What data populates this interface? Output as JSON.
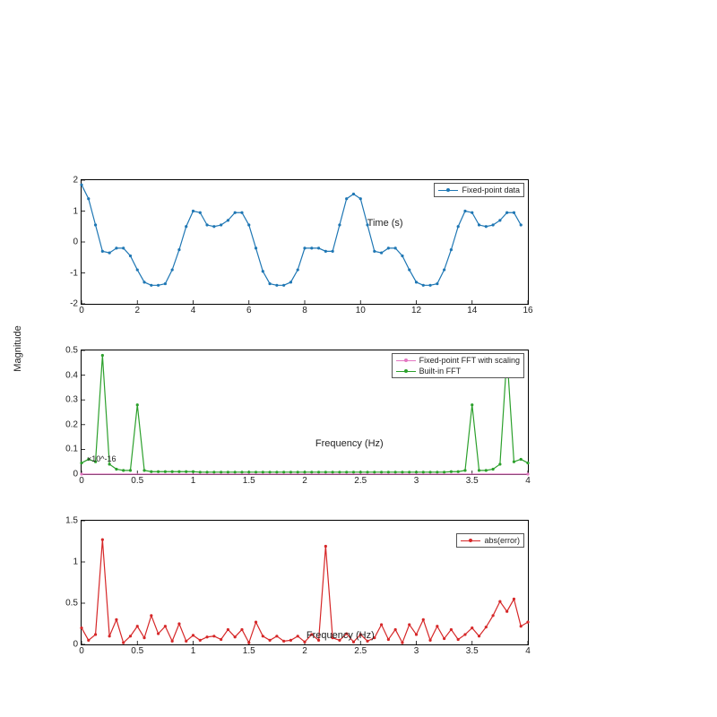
{
  "ylabel_shared": "Magnitude",
  "chart_data": [
    {
      "type": "line",
      "title": "",
      "xlabel_inplot": "Time (s)",
      "xlim": [
        0,
        16
      ],
      "ylim": [
        -2,
        2
      ],
      "xticks": [
        0,
        2,
        4,
        6,
        8,
        10,
        12,
        14,
        16
      ],
      "yticks": [
        -2,
        -1,
        0,
        1,
        2
      ],
      "legend": [
        {
          "name": "Fixed-point data",
          "color": "#1f77b4"
        }
      ],
      "series": [
        {
          "name": "Fixed-point data",
          "color": "#1f77b4",
          "x": [
            0,
            0.25,
            0.5,
            0.75,
            1,
            1.25,
            1.5,
            1.75,
            2,
            2.25,
            2.5,
            2.75,
            3,
            3.25,
            3.5,
            3.75,
            4,
            4.25,
            4.5,
            4.75,
            5,
            5.25,
            5.5,
            5.75,
            6,
            6.25,
            6.5,
            6.75,
            7,
            7.25,
            7.5,
            7.75,
            8,
            8.25,
            8.5,
            8.75,
            9,
            9.25,
            9.5,
            9.75,
            10,
            10.25,
            10.5,
            10.75,
            11,
            11.25,
            11.5,
            11.75,
            12,
            12.25,
            12.5,
            12.75,
            13,
            13.25,
            13.5,
            13.75,
            14,
            14.25,
            14.5,
            14.75,
            15,
            15.25,
            15.5,
            15.75
          ],
          "y": [
            1.85,
            1.4,
            0.55,
            -0.3,
            -0.35,
            -0.2,
            -0.2,
            -0.45,
            -0.9,
            -1.3,
            -1.4,
            -1.4,
            -1.35,
            -0.9,
            -0.25,
            0.5,
            1.0,
            0.95,
            0.55,
            0.5,
            0.55,
            0.7,
            0.95,
            0.95,
            0.55,
            -0.2,
            -0.95,
            -1.35,
            -1.4,
            -1.4,
            -1.3,
            -0.9,
            -0.2,
            -0.2,
            -0.2,
            -0.3,
            -0.3,
            0.55,
            1.4,
            1.55,
            1.4,
            0.55,
            -0.3,
            -0.35,
            -0.2,
            -0.2,
            -0.45,
            -0.9,
            -1.3,
            -1.4,
            -1.4,
            -1.35,
            -0.9,
            -0.25,
            0.5,
            1.0,
            0.95,
            0.55,
            0.5,
            0.55,
            0.7,
            0.95,
            0.95,
            0.55
          ]
        }
      ]
    },
    {
      "type": "line",
      "title": "",
      "xlabel_inplot": "Frequency (Hz)",
      "xlim": [
        0,
        4
      ],
      "ylim": [
        0,
        0.5
      ],
      "xticks": [
        0,
        0.5,
        1,
        1.5,
        2,
        2.5,
        3,
        3.5,
        4
      ],
      "yticks": [
        0,
        0.1,
        0.2,
        0.3,
        0.4,
        0.5
      ],
      "exp_tag": "×10^-16",
      "legend": [
        {
          "name": "Fixed-point FFT with scaling",
          "color": "#e377c2"
        },
        {
          "name": "Built-in FFT",
          "color": "#2ca02c"
        }
      ],
      "series": [
        {
          "name": "Fixed-point FFT with scaling",
          "color": "#e377c2",
          "x": [
            0,
            4
          ],
          "y": [
            0,
            0
          ]
        },
        {
          "name": "Built-in FFT",
          "color": "#2ca02c",
          "x": [
            0,
            0.0625,
            0.125,
            0.1875,
            0.25,
            0.3125,
            0.375,
            0.4375,
            0.5,
            0.5625,
            0.625,
            0.6875,
            0.75,
            0.8125,
            0.875,
            0.9375,
            1,
            1.0625,
            1.125,
            1.1875,
            1.25,
            1.3125,
            1.375,
            1.4375,
            1.5,
            1.5625,
            1.625,
            1.6875,
            1.75,
            1.8125,
            1.875,
            1.9375,
            2,
            2.0625,
            2.125,
            2.1875,
            2.25,
            2.3125,
            2.375,
            2.4375,
            2.5,
            2.5625,
            2.625,
            2.6875,
            2.75,
            2.8125,
            2.875,
            2.9375,
            3,
            3.0625,
            3.125,
            3.1875,
            3.25,
            3.3125,
            3.375,
            3.4375,
            3.5,
            3.5625,
            3.625,
            3.6875,
            3.75,
            3.8125,
            3.875,
            3.9375,
            4
          ],
          "y": [
            0.045,
            0.06,
            0.05,
            0.48,
            0.04,
            0.02,
            0.015,
            0.015,
            0.28,
            0.015,
            0.01,
            0.01,
            0.01,
            0.01,
            0.01,
            0.01,
            0.01,
            0.008,
            0.008,
            0.008,
            0.008,
            0.008,
            0.008,
            0.008,
            0.008,
            0.008,
            0.008,
            0.008,
            0.008,
            0.008,
            0.008,
            0.008,
            0.008,
            0.008,
            0.008,
            0.008,
            0.008,
            0.008,
            0.008,
            0.008,
            0.008,
            0.008,
            0.008,
            0.008,
            0.008,
            0.008,
            0.008,
            0.008,
            0.008,
            0.008,
            0.008,
            0.008,
            0.008,
            0.01,
            0.01,
            0.015,
            0.28,
            0.015,
            0.015,
            0.02,
            0.04,
            0.48,
            0.05,
            0.06,
            0.045
          ]
        }
      ]
    },
    {
      "type": "line",
      "title": "",
      "xlabel_inplot": "Frequency (Hz)",
      "xlim": [
        0,
        4
      ],
      "ylim": [
        0,
        1.5
      ],
      "xticks": [
        0,
        0.5,
        1,
        1.5,
        2,
        2.5,
        3,
        3.5,
        4
      ],
      "yticks": [
        0,
        0.5,
        1,
        1.5
      ],
      "legend": [
        {
          "name": "abs(error)",
          "color": "#d62728"
        }
      ],
      "series": [
        {
          "name": "abs(error)",
          "color": "#d62728",
          "x": [
            0,
            0.0625,
            0.125,
            0.1875,
            0.25,
            0.3125,
            0.375,
            0.4375,
            0.5,
            0.5625,
            0.625,
            0.6875,
            0.75,
            0.8125,
            0.875,
            0.9375,
            1,
            1.0625,
            1.125,
            1.1875,
            1.25,
            1.3125,
            1.375,
            1.4375,
            1.5,
            1.5625,
            1.625,
            1.6875,
            1.75,
            1.8125,
            1.875,
            1.9375,
            2,
            2.0625,
            2.125,
            2.1875,
            2.25,
            2.3125,
            2.375,
            2.4375,
            2.5,
            2.5625,
            2.625,
            2.6875,
            2.75,
            2.8125,
            2.875,
            2.9375,
            3,
            3.0625,
            3.125,
            3.1875,
            3.25,
            3.3125,
            3.375,
            3.4375,
            3.5,
            3.5625,
            3.625,
            3.6875,
            3.75,
            3.8125,
            3.875,
            3.9375,
            4
          ],
          "y": [
            0.2,
            0.05,
            0.12,
            1.27,
            0.1,
            0.3,
            0.02,
            0.1,
            0.22,
            0.08,
            0.35,
            0.13,
            0.22,
            0.04,
            0.25,
            0.04,
            0.11,
            0.05,
            0.09,
            0.1,
            0.06,
            0.18,
            0.09,
            0.18,
            0.02,
            0.27,
            0.1,
            0.05,
            0.1,
            0.04,
            0.05,
            0.1,
            0.03,
            0.12,
            0.05,
            1.19,
            0.08,
            0.05,
            0.13,
            0.03,
            0.12,
            0.04,
            0.08,
            0.24,
            0.06,
            0.18,
            0.02,
            0.24,
            0.12,
            0.3,
            0.05,
            0.22,
            0.07,
            0.18,
            0.06,
            0.12,
            0.2,
            0.1,
            0.21,
            0.35,
            0.52,
            0.4,
            0.55,
            0.22,
            0.27
          ]
        }
      ]
    }
  ]
}
